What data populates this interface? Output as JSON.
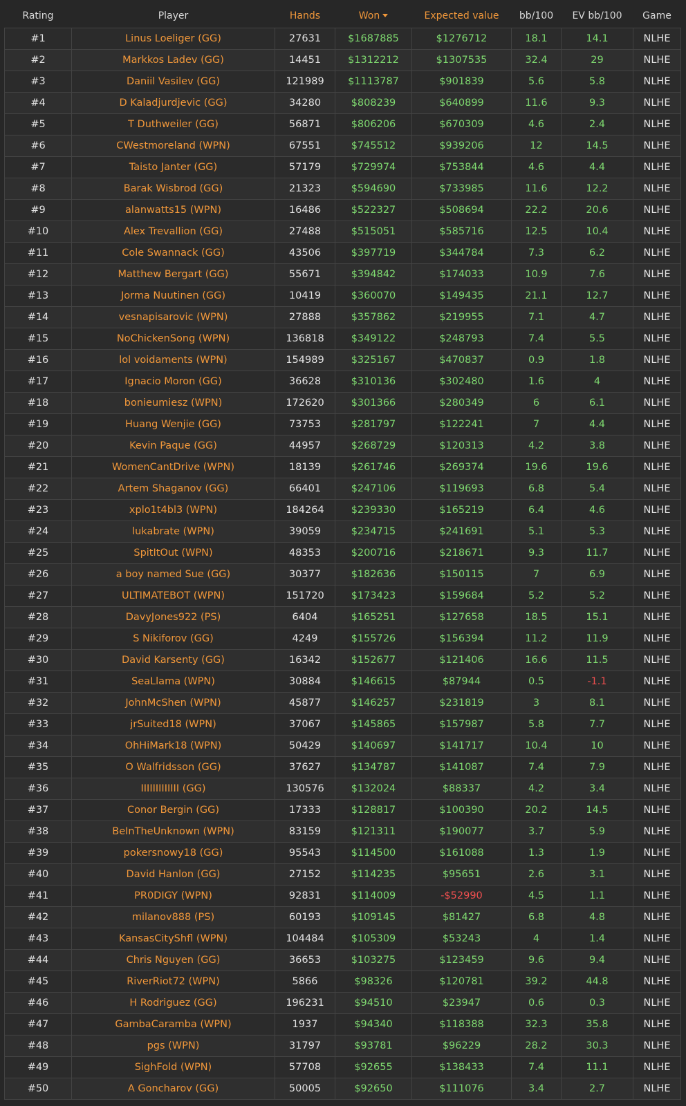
{
  "colors": {
    "accent": "#f0973a",
    "positive": "#7ed86f",
    "negative": "#ef4f4f",
    "background": "#272727"
  },
  "header": {
    "rating": "Rating",
    "player": "Player",
    "hands": "Hands",
    "won": "Won",
    "ev": "Expected value",
    "bb100": "bb/100",
    "evbb100": "EV bb/100",
    "game": "Game",
    "sort_icon": "caret-down-icon"
  },
  "rows": [
    {
      "rating": "#1",
      "player": "Linus Loeliger (GG)",
      "hands": "27631",
      "won": "$1687885",
      "ev": "$1276712",
      "bb": "18.1",
      "evbb": "14.1",
      "game": "NLHE"
    },
    {
      "rating": "#2",
      "player": "Markkos Ladev (GG)",
      "hands": "14451",
      "won": "$1312212",
      "ev": "$1307535",
      "bb": "32.4",
      "evbb": "29",
      "game": "NLHE"
    },
    {
      "rating": "#3",
      "player": "Daniil Vasilev (GG)",
      "hands": "121989",
      "won": "$1113787",
      "ev": "$901839",
      "bb": "5.6",
      "evbb": "5.8",
      "game": "NLHE"
    },
    {
      "rating": "#4",
      "player": "D Kaladjurdjevic (GG)",
      "hands": "34280",
      "won": "$808239",
      "ev": "$640899",
      "bb": "11.6",
      "evbb": "9.3",
      "game": "NLHE"
    },
    {
      "rating": "#5",
      "player": "T Duthweiler (GG)",
      "hands": "56871",
      "won": "$806206",
      "ev": "$670309",
      "bb": "4.6",
      "evbb": "2.4",
      "game": "NLHE"
    },
    {
      "rating": "#6",
      "player": "CWestmoreland (WPN)",
      "hands": "67551",
      "won": "$745512",
      "ev": "$939206",
      "bb": "12",
      "evbb": "14.5",
      "game": "NLHE"
    },
    {
      "rating": "#7",
      "player": "Taisto Janter (GG)",
      "hands": "57179",
      "won": "$729974",
      "ev": "$753844",
      "bb": "4.6",
      "evbb": "4.4",
      "game": "NLHE"
    },
    {
      "rating": "#8",
      "player": "Barak Wisbrod (GG)",
      "hands": "21323",
      "won": "$594690",
      "ev": "$733985",
      "bb": "11.6",
      "evbb": "12.2",
      "game": "NLHE"
    },
    {
      "rating": "#9",
      "player": "alanwatts15 (WPN)",
      "hands": "16486",
      "won": "$522327",
      "ev": "$508694",
      "bb": "22.2",
      "evbb": "20.6",
      "game": "NLHE"
    },
    {
      "rating": "#10",
      "player": "Alex Trevallion (GG)",
      "hands": "27488",
      "won": "$515051",
      "ev": "$585716",
      "bb": "12.5",
      "evbb": "10.4",
      "game": "NLHE"
    },
    {
      "rating": "#11",
      "player": "Cole Swannack (GG)",
      "hands": "43506",
      "won": "$397719",
      "ev": "$344784",
      "bb": "7.3",
      "evbb": "6.2",
      "game": "NLHE"
    },
    {
      "rating": "#12",
      "player": "Matthew Bergart (GG)",
      "hands": "55671",
      "won": "$394842",
      "ev": "$174033",
      "bb": "10.9",
      "evbb": "7.6",
      "game": "NLHE"
    },
    {
      "rating": "#13",
      "player": "Jorma Nuutinen (GG)",
      "hands": "10419",
      "won": "$360070",
      "ev": "$149435",
      "bb": "21.1",
      "evbb": "12.7",
      "game": "NLHE"
    },
    {
      "rating": "#14",
      "player": "vesnapisarovic (WPN)",
      "hands": "27888",
      "won": "$357862",
      "ev": "$219955",
      "bb": "7.1",
      "evbb": "4.7",
      "game": "NLHE"
    },
    {
      "rating": "#15",
      "player": "NoChickenSong (WPN)",
      "hands": "136818",
      "won": "$349122",
      "ev": "$248793",
      "bb": "7.4",
      "evbb": "5.5",
      "game": "NLHE"
    },
    {
      "rating": "#16",
      "player": "lol voidaments (WPN)",
      "hands": "154989",
      "won": "$325167",
      "ev": "$470837",
      "bb": "0.9",
      "evbb": "1.8",
      "game": "NLHE"
    },
    {
      "rating": "#17",
      "player": "Ignacio Moron (GG)",
      "hands": "36628",
      "won": "$310136",
      "ev": "$302480",
      "bb": "1.6",
      "evbb": "4",
      "game": "NLHE"
    },
    {
      "rating": "#18",
      "player": "bonieumiesz (WPN)",
      "hands": "172620",
      "won": "$301366",
      "ev": "$280349",
      "bb": "6",
      "evbb": "6.1",
      "game": "NLHE"
    },
    {
      "rating": "#19",
      "player": "Huang Wenjie (GG)",
      "hands": "73753",
      "won": "$281797",
      "ev": "$122241",
      "bb": "7",
      "evbb": "4.4",
      "game": "NLHE"
    },
    {
      "rating": "#20",
      "player": "Kevin Paque (GG)",
      "hands": "44957",
      "won": "$268729",
      "ev": "$120313",
      "bb": "4.2",
      "evbb": "3.8",
      "game": "NLHE"
    },
    {
      "rating": "#21",
      "player": "WomenCantDrive (WPN)",
      "hands": "18139",
      "won": "$261746",
      "ev": "$269374",
      "bb": "19.6",
      "evbb": "19.6",
      "game": "NLHE"
    },
    {
      "rating": "#22",
      "player": "Artem Shaganov (GG)",
      "hands": "66401",
      "won": "$247106",
      "ev": "$119693",
      "bb": "6.8",
      "evbb": "5.4",
      "game": "NLHE"
    },
    {
      "rating": "#23",
      "player": "xplo1t4bl3 (WPN)",
      "hands": "184264",
      "won": "$239330",
      "ev": "$165219",
      "bb": "6.4",
      "evbb": "4.6",
      "game": "NLHE"
    },
    {
      "rating": "#24",
      "player": "lukabrate (WPN)",
      "hands": "39059",
      "won": "$234715",
      "ev": "$241691",
      "bb": "5.1",
      "evbb": "5.3",
      "game": "NLHE"
    },
    {
      "rating": "#25",
      "player": "SpitItOut (WPN)",
      "hands": "48353",
      "won": "$200716",
      "ev": "$218671",
      "bb": "9.3",
      "evbb": "11.7",
      "game": "NLHE"
    },
    {
      "rating": "#26",
      "player": "a boy named Sue (GG)",
      "hands": "30377",
      "won": "$182636",
      "ev": "$150115",
      "bb": "7",
      "evbb": "6.9",
      "game": "NLHE"
    },
    {
      "rating": "#27",
      "player": "ULTIMATEBOT (WPN)",
      "hands": "151720",
      "won": "$173423",
      "ev": "$159684",
      "bb": "5.2",
      "evbb": "5.2",
      "game": "NLHE"
    },
    {
      "rating": "#28",
      "player": "DavyJones922 (PS)",
      "hands": "6404",
      "won": "$165251",
      "ev": "$127658",
      "bb": "18.5",
      "evbb": "15.1",
      "game": "NLHE"
    },
    {
      "rating": "#29",
      "player": "S Nikiforov (GG)",
      "hands": "4249",
      "won": "$155726",
      "ev": "$156394",
      "bb": "11.2",
      "evbb": "11.9",
      "game": "NLHE"
    },
    {
      "rating": "#30",
      "player": "David Karsenty (GG)",
      "hands": "16342",
      "won": "$152677",
      "ev": "$121406",
      "bb": "16.6",
      "evbb": "11.5",
      "game": "NLHE"
    },
    {
      "rating": "#31",
      "player": "SeaLlama (WPN)",
      "hands": "30884",
      "won": "$146615",
      "ev": "$87944",
      "bb": "0.5",
      "evbb": "-1.1",
      "game": "NLHE"
    },
    {
      "rating": "#32",
      "player": "JohnMcShen (WPN)",
      "hands": "45877",
      "won": "$146257",
      "ev": "$231819",
      "bb": "3",
      "evbb": "8.1",
      "game": "NLHE"
    },
    {
      "rating": "#33",
      "player": "jrSuited18 (WPN)",
      "hands": "37067",
      "won": "$145865",
      "ev": "$157987",
      "bb": "5.8",
      "evbb": "7.7",
      "game": "NLHE"
    },
    {
      "rating": "#34",
      "player": "OhHiMark18 (WPN)",
      "hands": "50429",
      "won": "$140697",
      "ev": "$141717",
      "bb": "10.4",
      "evbb": "10",
      "game": "NLHE"
    },
    {
      "rating": "#35",
      "player": "O Walfridsson (GG)",
      "hands": "37627",
      "won": "$134787",
      "ev": "$141087",
      "bb": "7.4",
      "evbb": "7.9",
      "game": "NLHE"
    },
    {
      "rating": "#36",
      "player": "IIIIIIIIIIIII (GG)",
      "hands": "130576",
      "won": "$132024",
      "ev": "$88337",
      "bb": "4.2",
      "evbb": "3.4",
      "game": "NLHE"
    },
    {
      "rating": "#37",
      "player": "Conor Bergin (GG)",
      "hands": "17333",
      "won": "$128817",
      "ev": "$100390",
      "bb": "20.2",
      "evbb": "14.5",
      "game": "NLHE"
    },
    {
      "rating": "#38",
      "player": "BeInTheUnknown (WPN)",
      "hands": "83159",
      "won": "$121311",
      "ev": "$190077",
      "bb": "3.7",
      "evbb": "5.9",
      "game": "NLHE"
    },
    {
      "rating": "#39",
      "player": "pokersnowy18 (GG)",
      "hands": "95543",
      "won": "$114500",
      "ev": "$161088",
      "bb": "1.3",
      "evbb": "1.9",
      "game": "NLHE"
    },
    {
      "rating": "#40",
      "player": "David Hanlon (GG)",
      "hands": "27152",
      "won": "$114235",
      "ev": "$95651",
      "bb": "2.6",
      "evbb": "3.1",
      "game": "NLHE"
    },
    {
      "rating": "#41",
      "player": "PR0DIGY (WPN)",
      "hands": "92831",
      "won": "$114009",
      "ev": "-$52990",
      "bb": "4.5",
      "evbb": "1.1",
      "game": "NLHE"
    },
    {
      "rating": "#42",
      "player": "milanov888 (PS)",
      "hands": "60193",
      "won": "$109145",
      "ev": "$81427",
      "bb": "6.8",
      "evbb": "4.8",
      "game": "NLHE"
    },
    {
      "rating": "#43",
      "player": "KansasCityShfl (WPN)",
      "hands": "104484",
      "won": "$105309",
      "ev": "$53243",
      "bb": "4",
      "evbb": "1.4",
      "game": "NLHE"
    },
    {
      "rating": "#44",
      "player": "Chris Nguyen (GG)",
      "hands": "36653",
      "won": "$103275",
      "ev": "$123459",
      "bb": "9.6",
      "evbb": "9.4",
      "game": "NLHE"
    },
    {
      "rating": "#45",
      "player": "RiverRiot72 (WPN)",
      "hands": "5866",
      "won": "$98326",
      "ev": "$120781",
      "bb": "39.2",
      "evbb": "44.8",
      "game": "NLHE"
    },
    {
      "rating": "#46",
      "player": "H Rodriguez (GG)",
      "hands": "196231",
      "won": "$94510",
      "ev": "$23947",
      "bb": "0.6",
      "evbb": "0.3",
      "game": "NLHE"
    },
    {
      "rating": "#47",
      "player": "GambaCaramba (WPN)",
      "hands": "1937",
      "won": "$94340",
      "ev": "$118388",
      "bb": "32.3",
      "evbb": "35.8",
      "game": "NLHE"
    },
    {
      "rating": "#48",
      "player": "pgs (WPN)",
      "hands": "31797",
      "won": "$93781",
      "ev": "$96229",
      "bb": "28.2",
      "evbb": "30.3",
      "game": "NLHE"
    },
    {
      "rating": "#49",
      "player": "SighFold (WPN)",
      "hands": "57708",
      "won": "$92655",
      "ev": "$138433",
      "bb": "7.4",
      "evbb": "11.1",
      "game": "NLHE"
    },
    {
      "rating": "#50",
      "player": "A Goncharov (GG)",
      "hands": "50005",
      "won": "$92650",
      "ev": "$111076",
      "bb": "3.4",
      "evbb": "2.7",
      "game": "NLHE"
    }
  ]
}
